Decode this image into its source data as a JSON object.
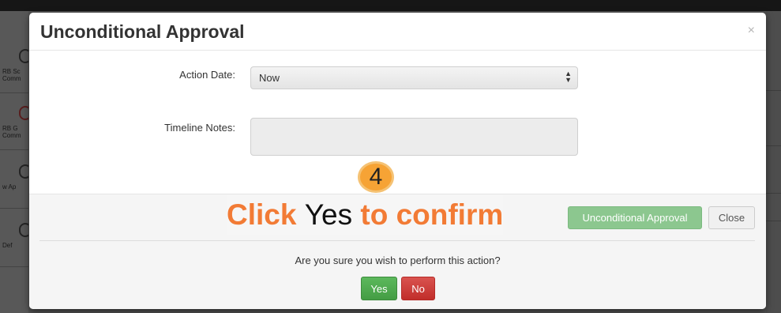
{
  "background": {
    "sidebar_tiles": [
      {
        "label": "RB Sc Comm",
        "icon": "clipboard-icon"
      },
      {
        "label": "RB G Comm",
        "icon": "clipboard-icon"
      },
      {
        "label": "w Ap",
        "icon": "refresh-icon"
      },
      {
        "label": "Def",
        "icon": "undo-icon"
      }
    ]
  },
  "modal": {
    "title": "Unconditional Approval",
    "close_glyph": "×",
    "action_date": {
      "label": "Action Date:",
      "value": "Now",
      "arrows": "▲▼"
    },
    "timeline_notes": {
      "label": "Timeline Notes:",
      "value": ""
    },
    "footer": {
      "approve_label": "Unconditional Approval",
      "close_label": "Close",
      "confirm_question": "Are you sure you wish to perform this action?",
      "yes_label": "Yes",
      "no_label": "No"
    }
  },
  "annotation": {
    "step_number": "4",
    "callout_part1": "Click ",
    "callout_part2": "Yes",
    "callout_part3": " to confirm",
    "colors": {
      "accent": "#f27b35",
      "step_circle": "#f6a335"
    }
  }
}
